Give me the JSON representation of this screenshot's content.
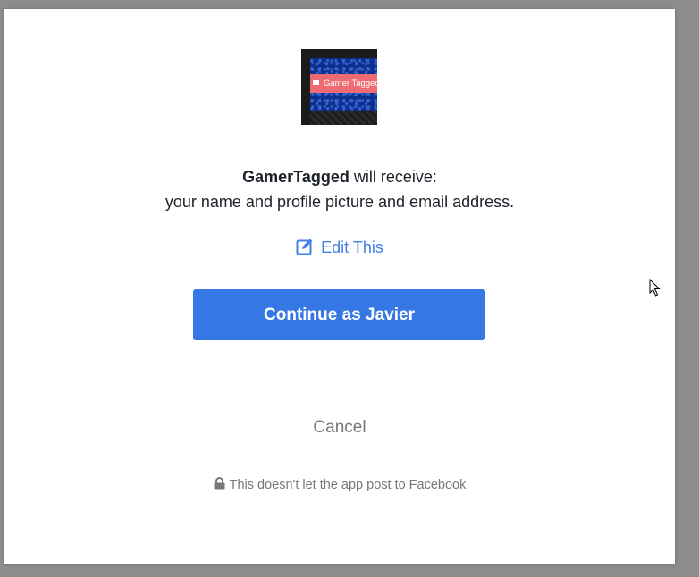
{
  "app": {
    "name": "GamerTagged",
    "logo_text": "Gamer Tagged"
  },
  "permission": {
    "app_name": "GamerTagged",
    "receive_suffix": " will receive:",
    "details": "your name and profile picture and email address."
  },
  "edit_link": {
    "label": "Edit This",
    "icon": "edit-icon"
  },
  "continue_button": {
    "label": "Continue as Javier"
  },
  "cancel_button": {
    "label": "Cancel"
  },
  "notice": {
    "text": "This doesn't let the app post to Facebook",
    "icon": "lock-icon"
  },
  "colors": {
    "accent": "#3578e5",
    "link": "#4080e8",
    "muted": "#777777",
    "text": "#1d2129",
    "backdrop": "#8c8c8c",
    "logo_banner": "#ef6b72"
  }
}
